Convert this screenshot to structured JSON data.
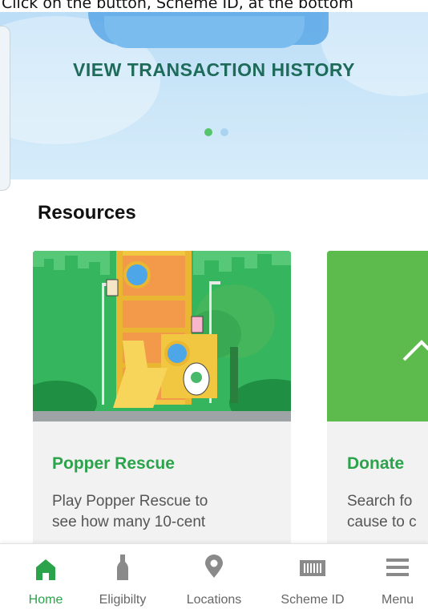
{
  "caption": "Click on the button, Scheme ID, at the bottom",
  "banner": {
    "title": "VIEW TRANSACTION HISTORY",
    "slides": 2,
    "active_slide": 1
  },
  "resources": {
    "heading": "Resources",
    "cards": [
      {
        "title": "Popper Rescue",
        "description": "Play Popper Rescue to\nsee how many 10-cent"
      },
      {
        "title": "Donate",
        "description": "Search fo\ncause to c"
      }
    ]
  },
  "nav": {
    "items": [
      {
        "label": "Home",
        "icon": "home-icon",
        "active": true
      },
      {
        "label": "Eligibilty",
        "icon": "bottle-icon",
        "active": false
      },
      {
        "label": "Locations",
        "icon": "location-pin-icon",
        "active": false
      },
      {
        "label": "Scheme ID",
        "icon": "barcode-icon",
        "active": false
      },
      {
        "label": "Menu",
        "icon": "hamburger-menu-icon",
        "active": false
      }
    ]
  },
  "colors": {
    "accent": "#2aa34a",
    "banner_title": "#1e6b5a",
    "inactive_icon": "#8a8a8a"
  }
}
